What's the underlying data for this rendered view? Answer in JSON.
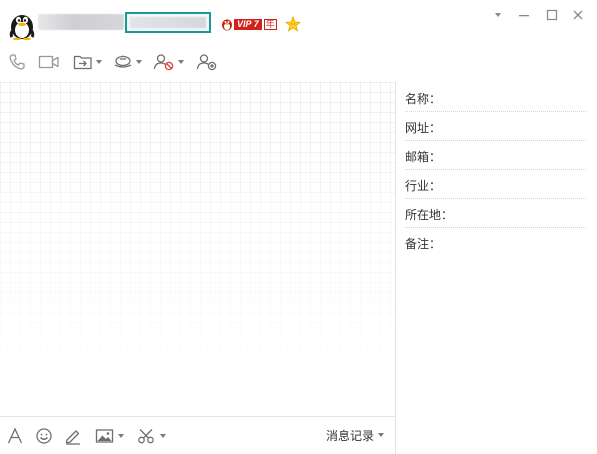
{
  "header": {
    "vip_label": "VIP 7",
    "vip_year": "年"
  },
  "toolbar": {
    "icons": [
      "phone-icon",
      "video-icon",
      "file-transfer-icon",
      "remote-assist-icon",
      "block-contact-icon",
      "add-contact-icon"
    ]
  },
  "window_controls": [
    "dropdown-icon",
    "minimize-icon",
    "maximize-icon",
    "close-icon"
  ],
  "bottom_toolbar": {
    "icons": [
      "font-icon",
      "emoji-icon",
      "pen-icon",
      "image-icon",
      "screenshot-scissors-icon"
    ],
    "history_label": "消息记录"
  },
  "info_panel": {
    "fields": [
      {
        "label": "名称：",
        "value": ""
      },
      {
        "label": "网址：",
        "value": ""
      },
      {
        "label": "邮箱：",
        "value": ""
      },
      {
        "label": "行业：",
        "value": ""
      },
      {
        "label": "所在地：",
        "value": ""
      },
      {
        "label": "备注：",
        "value": ""
      }
    ]
  },
  "colors": {
    "accent": "#1b9a95",
    "vip_red": "#d0231b",
    "icon_gray": "#8a8a8a"
  }
}
